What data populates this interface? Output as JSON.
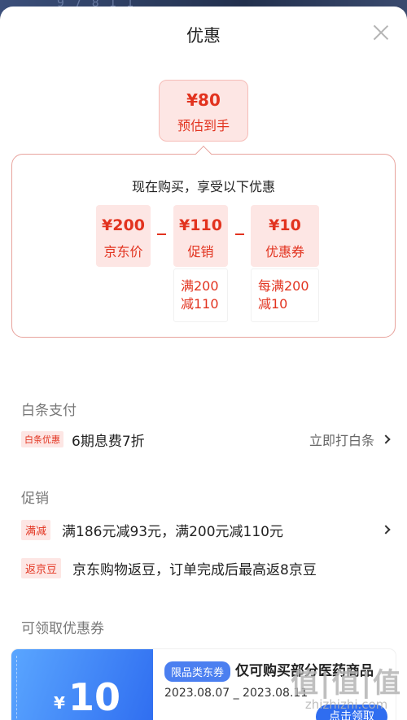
{
  "header": {
    "title": "优惠"
  },
  "estimate": {
    "price": "¥80",
    "label": "预估到手"
  },
  "calc": {
    "subtitle": "现在购买，享受以下优惠",
    "jd_price": {
      "value": "¥200",
      "label": "京东价"
    },
    "promo": {
      "value": "¥110",
      "label": "促销",
      "note_line1": "满200",
      "note_line2": "减110"
    },
    "coupon": {
      "value": "¥10",
      "label": "优惠券",
      "note_line1": "每满200",
      "note_line2": "减10"
    }
  },
  "baitiao": {
    "section_title": "白条支付",
    "tag": "白条优惠",
    "text": "6期息费7折",
    "action": "立即打白条"
  },
  "promotion": {
    "section_title": "促销",
    "items": [
      {
        "tag": "满减",
        "text": "满186元减93元，满200元减110元"
      },
      {
        "tag": "返京豆",
        "text": "京东购物返豆，订单完成后最高返8京豆"
      }
    ]
  },
  "coupons": {
    "section_title": "可领取优惠券",
    "card": {
      "currency": "¥",
      "amount": "10",
      "tag": "限品类东券",
      "desc": "仅可购买部分医药商品",
      "date": "2023.08.07 _ 2023.08.11",
      "claim": "点击领取"
    }
  },
  "watermark": {
    "big": "值|值|值",
    "small": "zhizhizhi.com"
  },
  "colors": {
    "accent_red": "#e2331f",
    "pale_red": "#fde6e4",
    "coupon_blue": "#2f6df0"
  }
}
